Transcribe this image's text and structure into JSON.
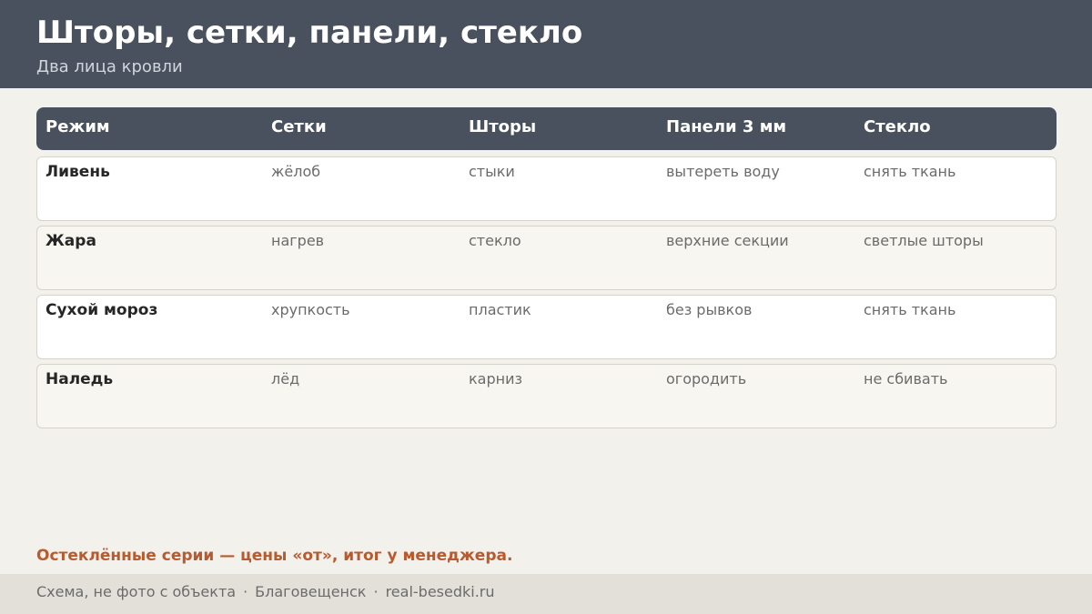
{
  "header": {
    "title": "Шторы, сетки, панели, стекло",
    "subtitle": "Два лица кровли"
  },
  "table": {
    "columns": [
      "Режим",
      "Сетки",
      "Шторы",
      "Панели 3 мм",
      "Стекло"
    ],
    "rows": [
      [
        "Ливень",
        "жёлоб",
        "стыки",
        "вытереть воду",
        "снять ткань"
      ],
      [
        "Жара",
        "нагрев",
        "стекло",
        "верхние секции",
        "светлые шторы"
      ],
      [
        "Сухой мороз",
        "хрупкость",
        "пластик",
        "без рывков",
        "снять ткань"
      ],
      [
        "Наледь",
        "лёд",
        "карниз",
        "огородить",
        "не сбивать"
      ]
    ]
  },
  "note": "Остеклённые серии — цены «от», итог у менеджера.",
  "footer": {
    "items": [
      "Схема, не фото с объекта",
      "Благовещенск",
      "real-besedki.ru"
    ],
    "separator": "·"
  },
  "colors": {
    "header_bg": "#48515d",
    "page_bg": "#f3f1ec",
    "accent": "#b85a2e",
    "footer_bg": "#e3e0da"
  }
}
